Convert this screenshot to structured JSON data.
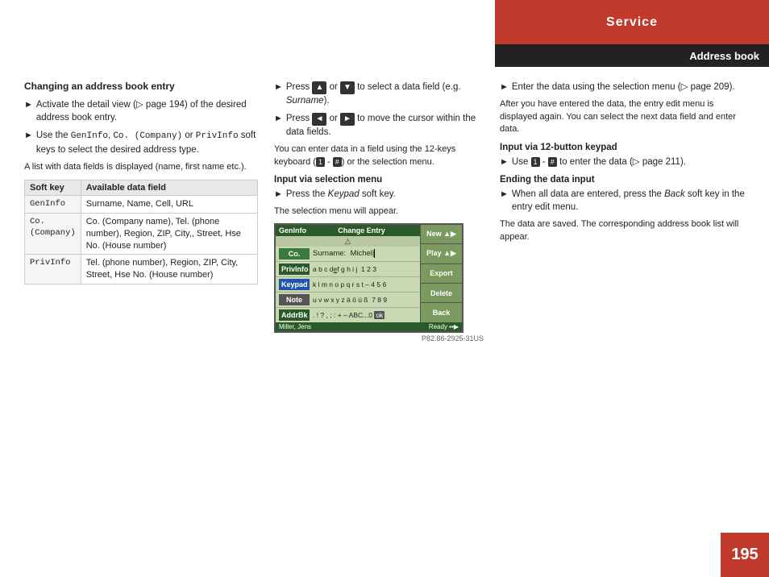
{
  "header": {
    "service_label": "Service",
    "address_book_label": "Address book",
    "page_number": "195"
  },
  "left_column": {
    "title": "Changing an address book entry",
    "bullets": [
      {
        "text": "Activate the detail view (▷ page 194) of the desired address book entry."
      },
      {
        "text": "Use the GenInfo, Co. (Company) or PrivInfo soft keys to select the desired address type."
      }
    ],
    "note1": "A list with data fields is displayed (name, first name etc.).",
    "table": {
      "headers": [
        "Soft key",
        "Available data field"
      ],
      "rows": [
        {
          "key": "GenInfo",
          "value": "Surname, Name, Cell, URL"
        },
        {
          "key": "Co.\n(Company)",
          "value": "Co. (Company name), Tel. (phone number), Region, ZIP, City,, Street, Hse No. (House number)"
        },
        {
          "key": "PrivInfo",
          "value": "Tel. (phone number), Region, ZIP, City, Street, Hse No. (House number)"
        }
      ]
    }
  },
  "middle_column": {
    "bullets": [
      {
        "text": "Press ▲ or ▼ to select a data field (e.g. Surname)."
      },
      {
        "text": "Press ◄ or ► to move the cursor within the data fields."
      }
    ],
    "note1": "You can enter data in a field using the 12-keys keyboard (1 - #) or the selection menu.",
    "subsection1": "Input via selection menu",
    "bullet2": "Press the Keypad soft key.",
    "note2": "The selection menu will appear.",
    "screen": {
      "header_left": "GenInfo",
      "header_title": "Change Entry",
      "header_triangle": "△",
      "softkeys": [
        "New ▲▶",
        "Play ▲▶",
        "Export",
        "Delete",
        "Back"
      ],
      "rows": [
        {
          "label": "Co.",
          "content": "Surname:  Michel|",
          "active": false
        },
        {
          "label": "PrivInfo",
          "content": "a b c d e f g h i j  1 2 3",
          "active": false
        },
        {
          "label": "Keypad",
          "content": "k l m n o p q r s t – 4 5 6",
          "active": false
        },
        {
          "label": "Note",
          "content": "u v w x y z ä ö ü ß  7 8 9",
          "active": false
        },
        {
          "label": "AddrBk",
          "content": ". ! ? , ; : + – ABC...0 ok",
          "active": false
        }
      ],
      "footer_left": "Miller, Jens",
      "footer_right": "Ready ▪▪▶"
    },
    "img_code": "P82.86-2925-31US"
  },
  "right_column": {
    "bullets": [
      {
        "text": "Enter the data using the selection menu (▷ page 209)."
      }
    ],
    "note1": "After you have entered the data, the entry edit menu is displayed again. You can select the next data field and enter data.",
    "subsection1": "Input via 12-button keypad",
    "bullet2": "Use 1 - # to enter the data (▷ page 211).",
    "subsection2": "Ending the data input",
    "bullet3": "When all data are entered, press the Back soft key in the entry edit menu.",
    "note2": "The data are saved. The corresponding address book list will appear."
  }
}
